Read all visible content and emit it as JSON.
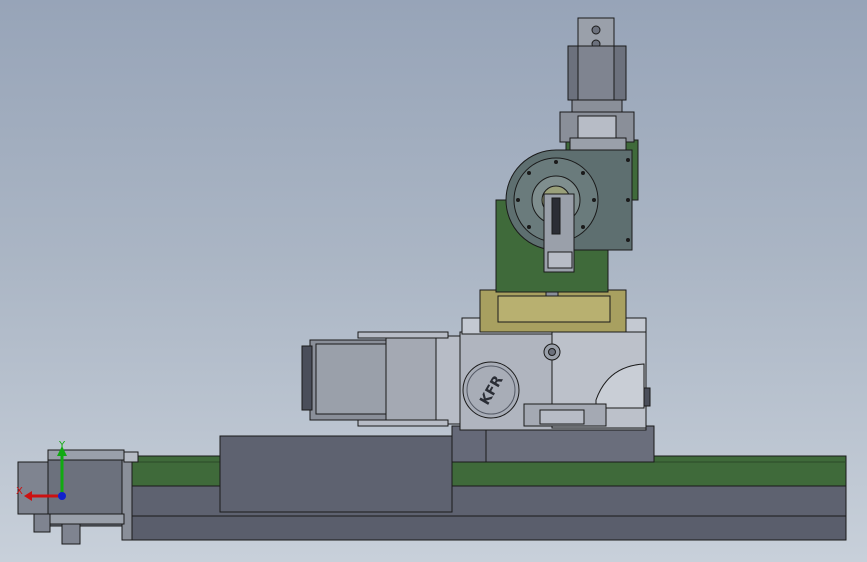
{
  "viewport": {
    "background_top": "#97a4b8",
    "background_bottom": "#c8d0da"
  },
  "triad": {
    "x_label": "X",
    "y_label": "Y",
    "x_color": "#cc1111",
    "y_color": "#11aa11",
    "z_color": "#1122cc"
  },
  "gearbox": {
    "logo_text": "KFR"
  },
  "colors": {
    "steel": "#8a8f99",
    "dark_steel": "#5e6270",
    "light_steel": "#b7bcc6",
    "green_plate": "#3f6a3a",
    "olive_band": "#a8a060",
    "outline": "#1a1a1a"
  }
}
